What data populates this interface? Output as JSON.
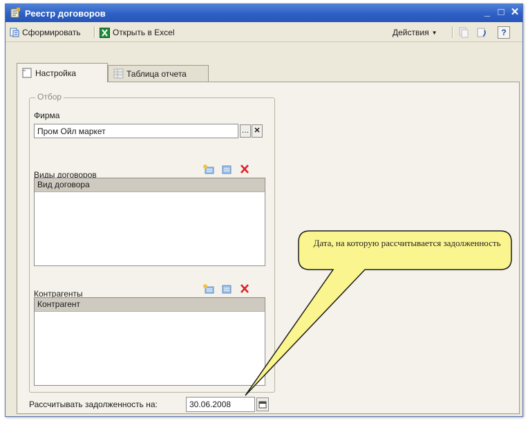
{
  "window": {
    "title": "Реестр договоров"
  },
  "toolbar": {
    "generate_label": "Сформировать",
    "excel_label": "Открыть в Excel",
    "actions_label": "Действия",
    "help_label": "?"
  },
  "tabs": [
    {
      "label": "Настройка",
      "active": true
    },
    {
      "label": "Таблица отчета",
      "active": false
    }
  ],
  "filter": {
    "legend": "Отбор",
    "firm": {
      "label": "Фирма",
      "value": "Пром Ойл маркет"
    },
    "contract_types": {
      "label": "Виды договоров",
      "column_header": "Вид договора"
    },
    "counterparties": {
      "label": "Контрагенты",
      "column_header": "Контрагент"
    }
  },
  "debt_date": {
    "label": "Рассчитывать задолженность на:",
    "value": "30.06.2008"
  },
  "callout": {
    "text": "Дата, на которую рассчитывается задолженность"
  },
  "colors": {
    "titlebar": "#2d5fc4",
    "callout_fill": "#fbf58f",
    "delete_red": "#e0202a"
  }
}
